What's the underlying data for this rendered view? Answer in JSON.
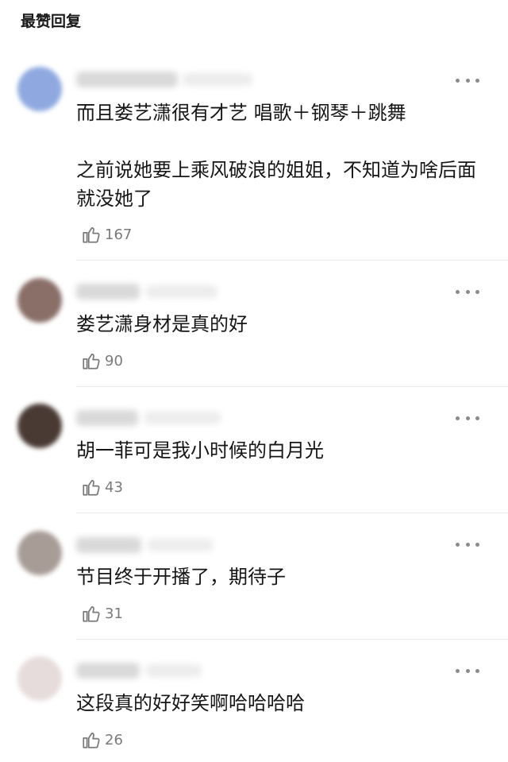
{
  "section": {
    "title": "最赞回复"
  },
  "comments": [
    {
      "paragraphs": [
        "而且娄艺潇很有才艺 唱歌＋钢琴＋跳舞",
        "之前说她要上乘风破浪的姐姐，不知道为啥后面就没她了"
      ],
      "likes": "167",
      "avatar_color": "#8fa9e0"
    },
    {
      "paragraphs": [
        "娄艺潇身材是真的好"
      ],
      "likes": "90",
      "avatar_color": "#8a6f68"
    },
    {
      "paragraphs": [
        "胡一菲可是我小时候的白月光"
      ],
      "likes": "43",
      "avatar_color": "#4a3a34"
    },
    {
      "paragraphs": [
        "节目终于开播了，期待子"
      ],
      "likes": "31",
      "avatar_color": "#a89c97"
    },
    {
      "paragraphs": [
        "这段真的好好笑啊哈哈哈哈"
      ],
      "likes": "26",
      "avatar_color": "#e7dcdc"
    }
  ],
  "icons": {
    "like": "thumbs-up-icon",
    "more": "more-dots-icon"
  }
}
